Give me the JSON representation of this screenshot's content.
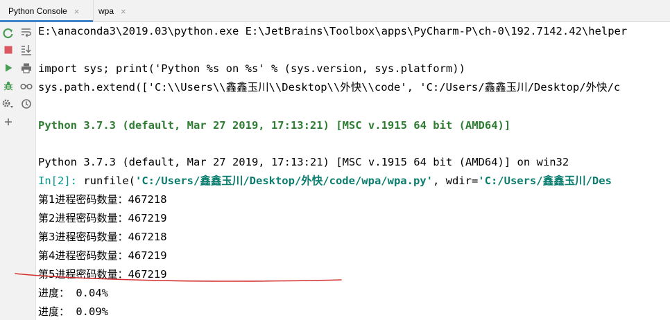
{
  "tabs": [
    {
      "label": "Python Console",
      "close": "×"
    },
    {
      "label": "wpa",
      "close": "×"
    }
  ],
  "icons": {
    "left": [
      "rerun-icon",
      "stop-icon",
      "run-icon",
      "debug-icon",
      "settings-icon",
      "add-icon"
    ],
    "right": [
      "soft-wrap-icon",
      "scroll-to-end-icon",
      "print-icon",
      "show-variables-icon",
      "history-icon"
    ]
  },
  "console": {
    "line1": "E:\\anaconda3\\2019.03\\python.exe E:\\JetBrains\\Toolbox\\apps\\PyCharm-P\\ch-0\\192.7142.42\\helper",
    "line2": "import sys; print('Python %s on %s' % (sys.version, sys.platform))",
    "line3": "sys.path.extend(['C:\\\\Users\\\\鑫鑫玉川\\\\Desktop\\\\外快\\\\code', 'C:/Users/鑫鑫玉川/Desktop/外快/c",
    "line4": "Python 3.7.3 (default, Mar 27 2019, 17:13:21) [MSC v.1915 64 bit (AMD64)]",
    "line5": "Python 3.7.3 (default, Mar 27 2019, 17:13:21) [MSC v.1915 64 bit (AMD64)] on win32",
    "prompt": "In[2]:",
    "runfile_pre": " runfile(",
    "runfile_path": "'C:/Users/鑫鑫玉川/Desktop/外快/code/wpa/wpa.py'",
    "runfile_mid": ", wdir=",
    "runfile_wdir": "'C:/Users/鑫鑫玉川/Des",
    "counts": [
      {
        "label": "第1进程密码数量：",
        "value": "467218"
      },
      {
        "label": "第2进程密码数量：",
        "value": "467219"
      },
      {
        "label": "第3进程密码数量：",
        "value": "467218"
      },
      {
        "label": "第4进程密码数量：",
        "value": "467219"
      },
      {
        "label": "第5进程密码数量：",
        "value": "467219"
      }
    ],
    "progress": [
      {
        "label": "进度：",
        "value": " 0.04%"
      },
      {
        "label": "进度：",
        "value": " 0.09%"
      }
    ]
  },
  "colors": {
    "tab_active": "#4083c9",
    "highlight_text": "#2e7d32",
    "string": "#0a7d6e",
    "annotation": "#d32f2f"
  }
}
